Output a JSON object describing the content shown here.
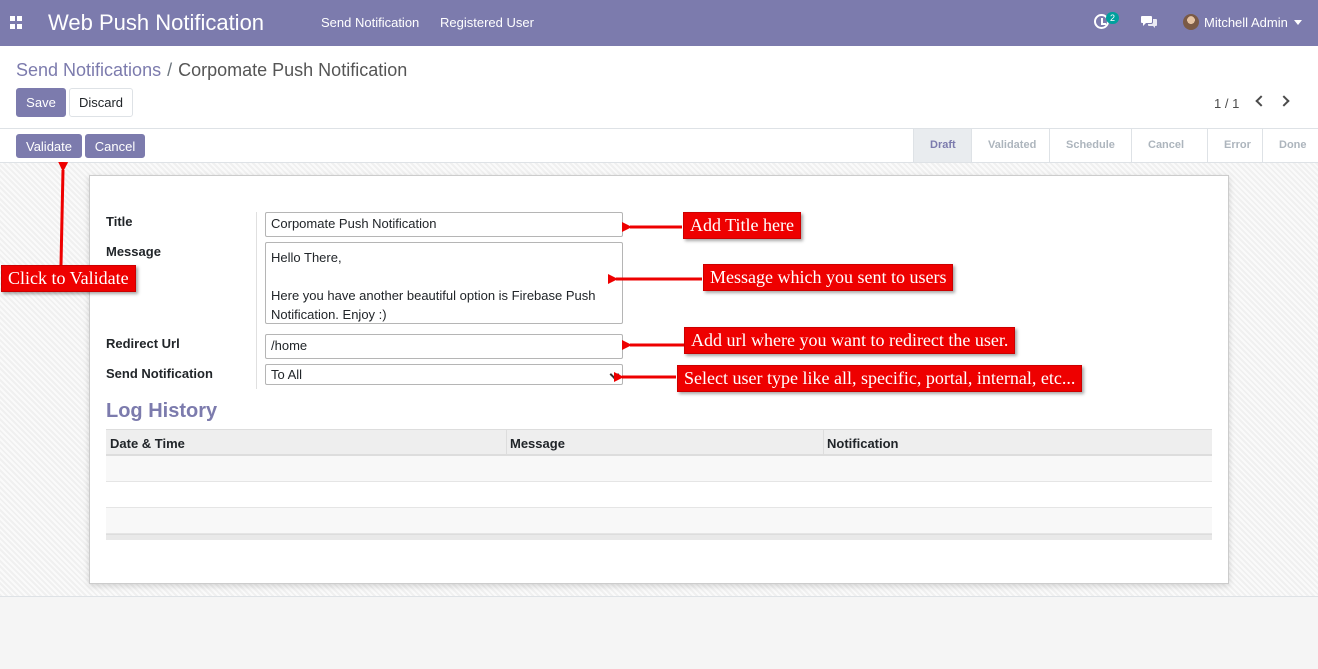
{
  "navbar": {
    "app_title": "Web Push Notification",
    "menu": [
      "Send Notification",
      "Registered User"
    ],
    "activity_badge": "2",
    "user_name": "Mitchell Admin"
  },
  "breadcrumb": {
    "parent": "Send Notifications",
    "separator": "/",
    "current": "Corpomate Push Notification"
  },
  "control": {
    "save_label": "Save",
    "discard_label": "Discard",
    "pager": "1 / 1"
  },
  "statusbar": {
    "validate_label": "Validate",
    "cancel_label": "Cancel",
    "stages": [
      "Draft",
      "Validated",
      "Schedule",
      "Cancel",
      "Error",
      "Done"
    ],
    "active_stage": "Draft"
  },
  "form": {
    "title_label": "Title",
    "title_value": "Corpomate Push Notification",
    "message_label": "Message",
    "message_lines": [
      "Hello There,",
      "",
      "Here you have another beautiful option is Firebase Push",
      "Notification. Enjoy  :)"
    ],
    "redirect_label": "Redirect Url",
    "redirect_value": "/home",
    "send_label": "Send Notification",
    "send_value": "To All"
  },
  "log": {
    "title": "Log History",
    "columns": [
      "Date & Time",
      "Message",
      "Notification"
    ]
  },
  "annotations": {
    "title": "Add Title here",
    "message": "Message which you sent to users",
    "url": "Add url where you want to redirect the user.",
    "send": "Select user type like all, specific, portal, internal, etc...",
    "validate": "Click to Validate"
  },
  "colors": {
    "brand": "#7c7bad",
    "annotation": "#ee0000",
    "badge": "#00a09d"
  }
}
